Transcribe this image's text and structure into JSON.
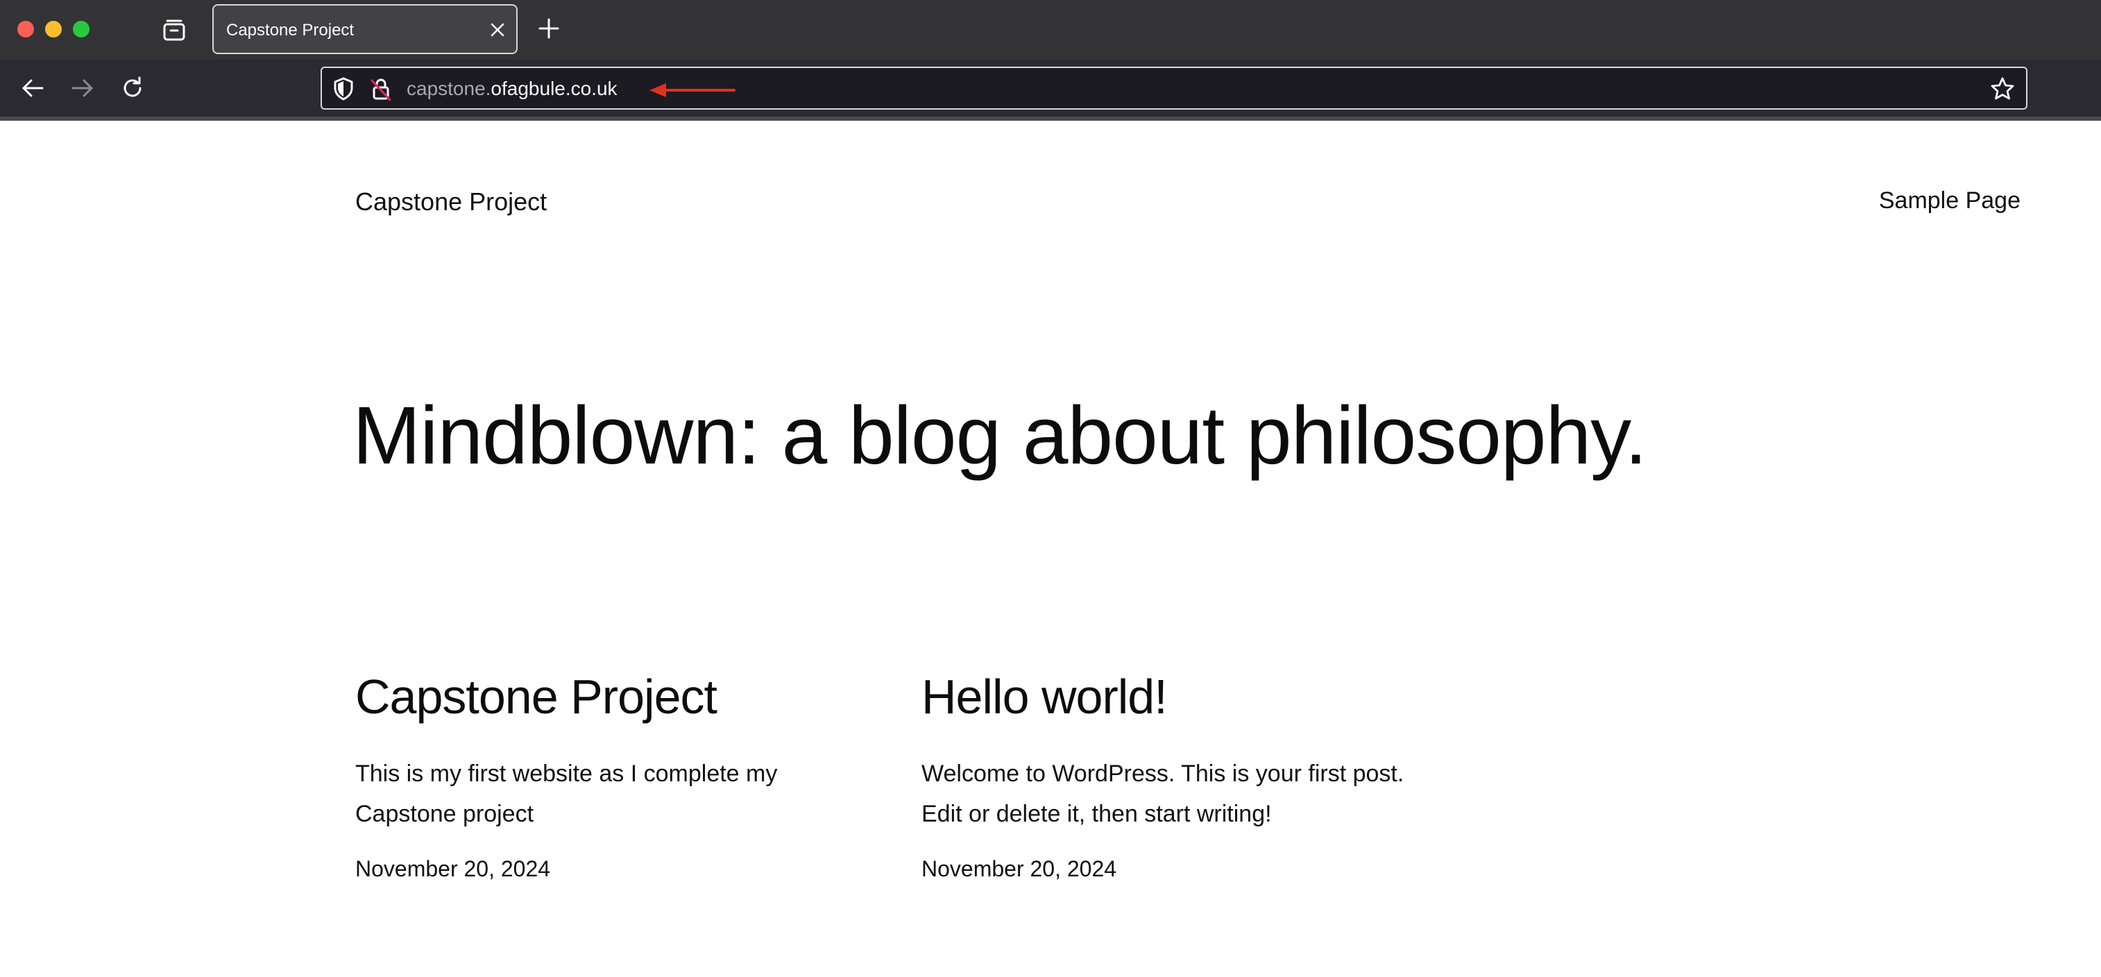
{
  "browser": {
    "tab": {
      "title": "Capstone Project"
    },
    "url": {
      "subdomain": "capstone.",
      "domain": "ofagbule.co.uk"
    },
    "colors": {
      "annotation_arrow": "#e0311f"
    }
  },
  "site": {
    "title": "Capstone Project",
    "nav": [
      "Sample Page"
    ]
  },
  "hero": {
    "heading": "Mindblown: a blog about philosophy."
  },
  "posts": [
    {
      "title": "Capstone Project",
      "excerpt": "This is my first website as I complete my Capstone project",
      "date": "November 20, 2024"
    },
    {
      "title": "Hello world!",
      "excerpt": "Welcome to WordPress. This is your first post. Edit or delete it, then start writing!",
      "date": "November 20, 2024"
    }
  ]
}
